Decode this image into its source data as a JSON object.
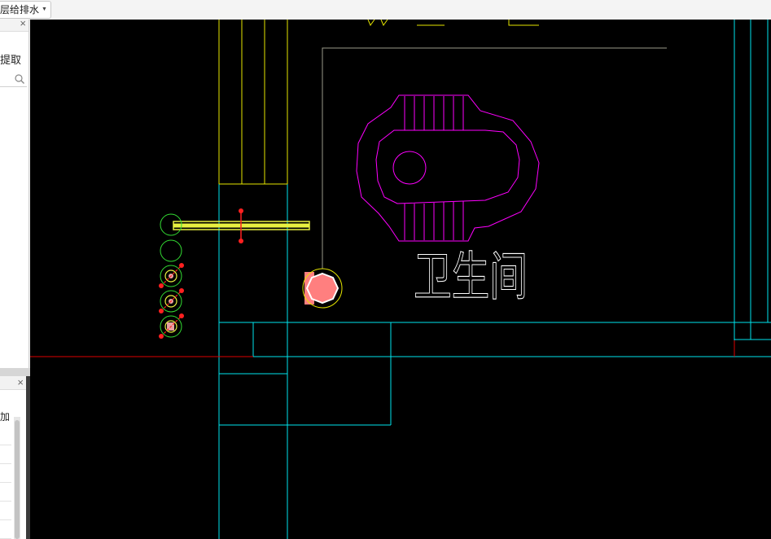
{
  "toolbar": {
    "layer_select": "层给排水"
  },
  "panel_top": {
    "close": "×",
    "extract_label": "提取",
    "search_placeholder": ""
  },
  "panel_bottom": {
    "close": "×",
    "label": "加"
  },
  "drawing": {
    "room_label": "卫生间",
    "colors": {
      "background": "#000000",
      "wall": "#00e5ee",
      "column": "#e6e600",
      "fixture": "#ff00ff",
      "text": "#ffffff",
      "pipe_ring": "#33dd33",
      "selection_grip": "#ff2020",
      "floor_drain": "#ff7f7f",
      "axis_line": "#dd0000",
      "pipe_highlight": "#e8f040"
    }
  }
}
